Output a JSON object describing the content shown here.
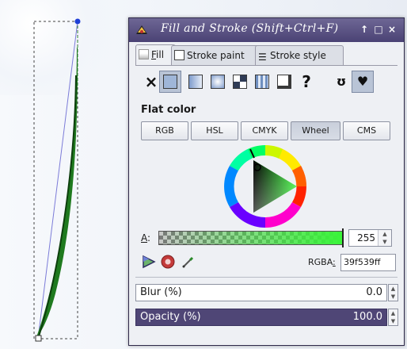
{
  "window": {
    "title": "Fill and Stroke (Shift+Ctrl+F)",
    "controls": {
      "pin": "↑",
      "maximize": "□",
      "close": "×"
    }
  },
  "tabs": [
    {
      "label_prefix": "",
      "mnemonic": "F",
      "label_rest": "ill",
      "icon": "fill-icon"
    },
    {
      "label": "Stroke paint",
      "icon": "stroke-paint-icon"
    },
    {
      "label": "Stroke style",
      "icon": "stroke-style-icon"
    }
  ],
  "paint_modes": [
    {
      "name": "no-paint",
      "glyph": "×"
    },
    {
      "name": "flat-color",
      "active": true
    },
    {
      "name": "linear-gradient"
    },
    {
      "name": "radial-gradient"
    },
    {
      "name": "mesh-gradient"
    },
    {
      "name": "pattern"
    },
    {
      "name": "swatch"
    },
    {
      "name": "unset",
      "glyph": "?"
    }
  ],
  "fill_rules": {
    "evenodd_glyph": "ʊ",
    "nonzero_glyph": "♥"
  },
  "section_label": "Flat color",
  "color_models": [
    {
      "label": "RGB"
    },
    {
      "label": "HSL"
    },
    {
      "label": "CMYK"
    },
    {
      "label": "Wheel",
      "active": true
    },
    {
      "label": "CMS"
    }
  ],
  "alpha": {
    "mnemonic": "A",
    "suffix": ":",
    "value": "255",
    "fraction": 1.0
  },
  "rgba": {
    "label_prefix": "RGBA",
    "mnemonic_suffix": ":",
    "value": "39f539ff"
  },
  "current_color": "#39f539",
  "blur": {
    "label": "Blur (%)",
    "value": "0.0"
  },
  "opacity": {
    "label": "Opacity (%)",
    "value": "100.0"
  },
  "colors": {
    "title_bar": "#4a4274",
    "selected_row": "#4f4676",
    "stroke_green": "#1f7a1f",
    "handle_blue": "#1f3fd6"
  }
}
